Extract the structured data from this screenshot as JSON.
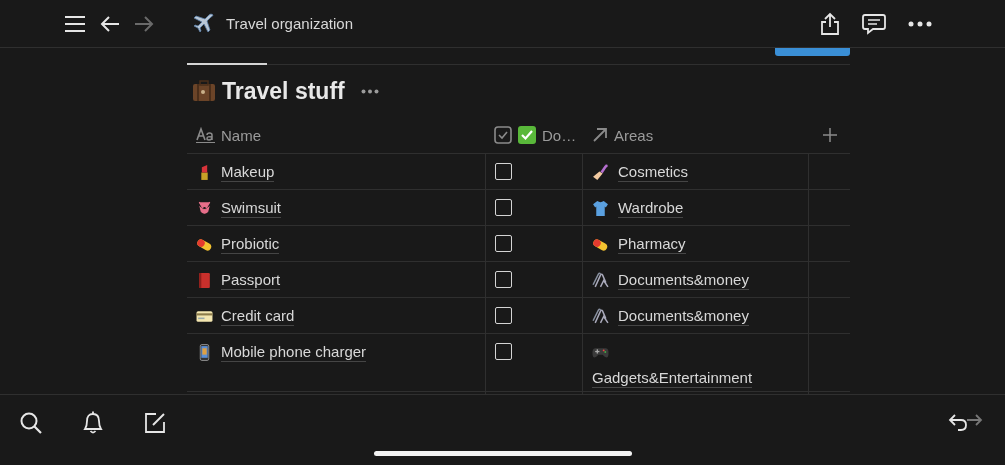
{
  "window": {
    "title": "Travel organization"
  },
  "nav": {
    "back_disabled": false,
    "forward_disabled": true
  },
  "database": {
    "title": "Travel stuff"
  },
  "columns": [
    {
      "label": "Name"
    },
    {
      "label": "Do…"
    },
    {
      "label": "Areas"
    }
  ],
  "rows": [
    {
      "name": "Makeup",
      "done": false,
      "area": "Cosmetics"
    },
    {
      "name": "Swimsuit",
      "done": false,
      "area": "Wardrobe"
    },
    {
      "name": "Probiotic",
      "done": false,
      "area": "Pharmacy"
    },
    {
      "name": "Passport",
      "done": false,
      "area": "Documents&money"
    },
    {
      "name": "Credit card",
      "done": false,
      "area": "Documents&money"
    },
    {
      "name": "Mobile phone charger",
      "done": false,
      "area": "Gadgets&Entertainment"
    }
  ]
}
